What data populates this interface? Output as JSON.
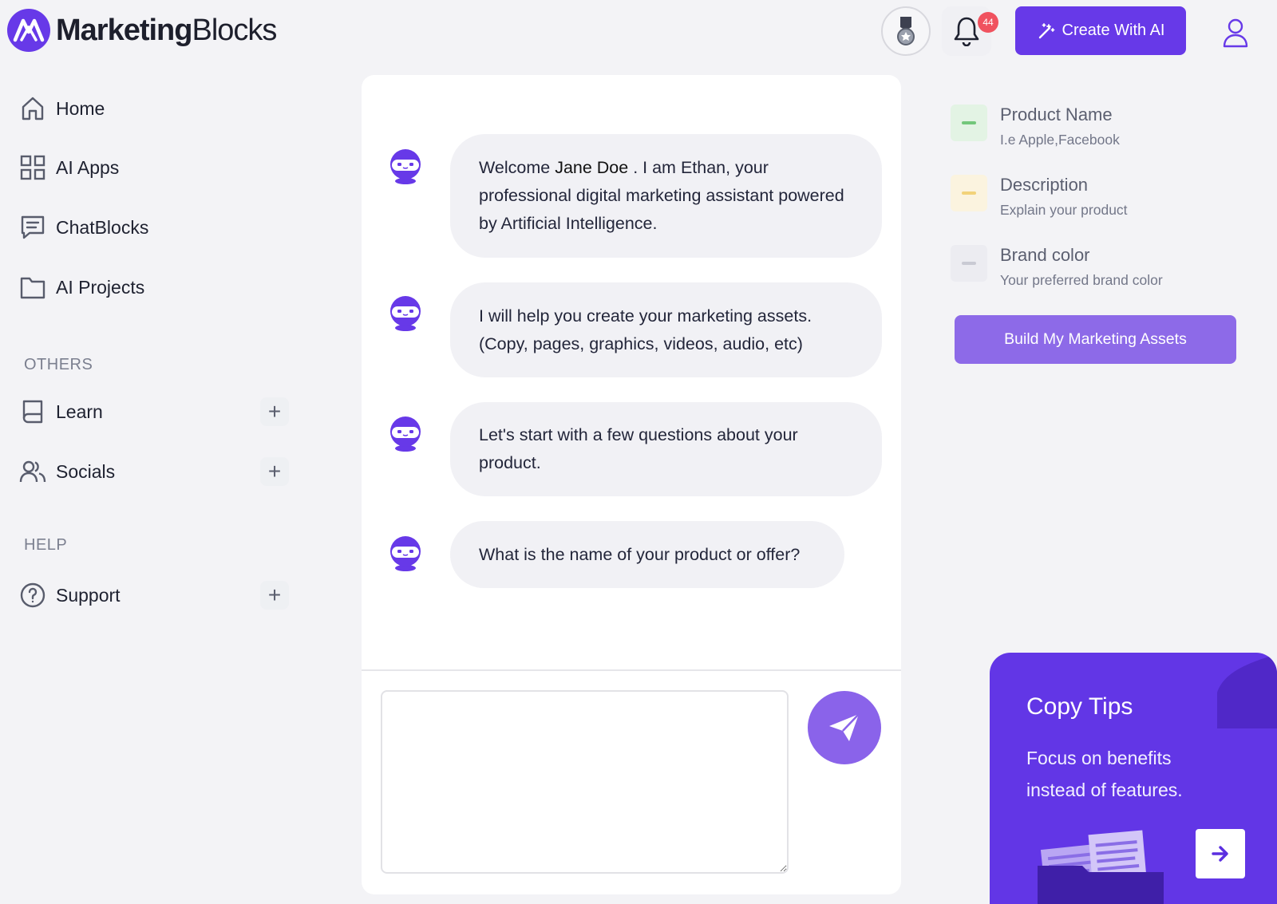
{
  "brand": {
    "name_bold": "Marketing",
    "name_regular": "Blocks",
    "accent": "#6739e8"
  },
  "header": {
    "notifications_count": "44",
    "create_label": "Create With AI",
    "icons": [
      "medal-icon",
      "bell-icon",
      "magic-wand-icon",
      "user-icon"
    ]
  },
  "sidebar": {
    "items": [
      {
        "label": "Home",
        "icon": "home-icon"
      },
      {
        "label": "AI Apps",
        "icon": "grid-icon"
      },
      {
        "label": "ChatBlocks",
        "icon": "chat-icon"
      },
      {
        "label": "AI Projects",
        "icon": "folder-icon"
      }
    ],
    "others_label": "OTHERS",
    "others": [
      {
        "label": "Learn",
        "icon": "book-icon"
      },
      {
        "label": "Socials",
        "icon": "users-icon"
      }
    ],
    "help_label": "HELP",
    "help": [
      {
        "label": "Support",
        "icon": "question-icon"
      }
    ]
  },
  "chat": {
    "messages": [
      {
        "pre": "Welcome ",
        "name": "Jane Doe",
        "post": " . I am Ethan, your professional digital marketing assistant powered by Artificial Intelligence."
      },
      {
        "text": "I will help you create your marketing assets. (Copy, pages, graphics, videos, audio, etc)"
      },
      {
        "text": "Let's start with a few questions about your product."
      },
      {
        "text": "What is the name of your product or offer?"
      }
    ],
    "input_value": "",
    "send_icon": "paper-plane-icon"
  },
  "form": {
    "fields": [
      {
        "title": "Product Name",
        "sub": "I.e Apple,Facebook",
        "color": "#e3f3e4",
        "dash": "#73c77b"
      },
      {
        "title": "Description",
        "sub": "Explain your product",
        "color": "#fbf3df",
        "dash": "#f2d27a"
      },
      {
        "title": "Brand color",
        "sub": "Your preferred brand color",
        "color": "#ececf1",
        "dash": "#c9cad3"
      }
    ],
    "build_label": "Build My Marketing Assets"
  },
  "tips": {
    "title": "Copy Tips",
    "text": "Focus on benefits instead of features.",
    "arrow_icon": "arrow-right-icon"
  }
}
